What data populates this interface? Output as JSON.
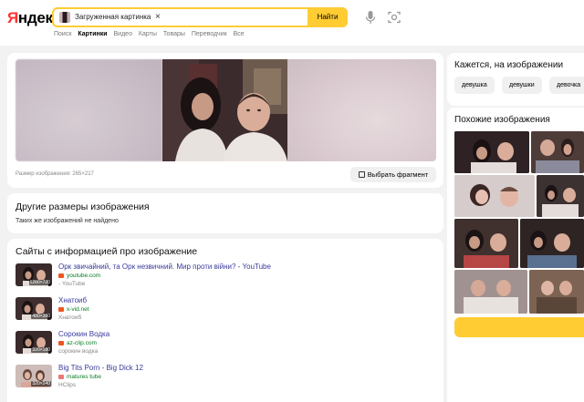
{
  "header": {
    "logo": "Яндекс",
    "search": {
      "chip_label": "Загруженная картинка",
      "close": "×",
      "button": "Найти"
    },
    "tabs": [
      {
        "label": "Поиск",
        "active": false
      },
      {
        "label": "Картинки",
        "active": true
      },
      {
        "label": "Видео",
        "active": false
      },
      {
        "label": "Карты",
        "active": false
      },
      {
        "label": "Товары",
        "active": false
      },
      {
        "label": "Переводчик",
        "active": false
      },
      {
        "label": "Все",
        "active": false
      }
    ]
  },
  "main": {
    "size_text": "Размер изображения: 265×217",
    "fragment_button": "Выбрать фрагмент"
  },
  "sizes": {
    "title": "Другие размеры изображения",
    "not_found": "Таких же изображений не найдено"
  },
  "sites": {
    "title": "Сайты с информацией про изображение",
    "items": [
      {
        "title": "Орк звичайний, та Орк незвичний. Мир проти війни? - YouTube",
        "domain": "youtube.com",
        "sub": "- YouTube",
        "res": "1280×720"
      },
      {
        "title": "Хнатоиб",
        "domain": "x-vid.net",
        "sub": "Хнатоиб",
        "res": "480×360"
      },
      {
        "title": "Сорокин Водка",
        "domain": "az-clip.com",
        "sub": "сорокин водка",
        "res": "320×180"
      },
      {
        "title": "Big Tits Porn - Big Dick 12",
        "domain": "matures tube",
        "sub": "HClips",
        "res": "320×240"
      }
    ]
  },
  "tags": {
    "title": "Кажется, на изображении",
    "items": [
      "девушка",
      "девушки",
      "девочка"
    ]
  },
  "similar": {
    "title": "Похожие изображения"
  },
  "colors": {
    "accent": "#ffcc33",
    "link": "#3a3a9c",
    "domain": "#067b22"
  }
}
